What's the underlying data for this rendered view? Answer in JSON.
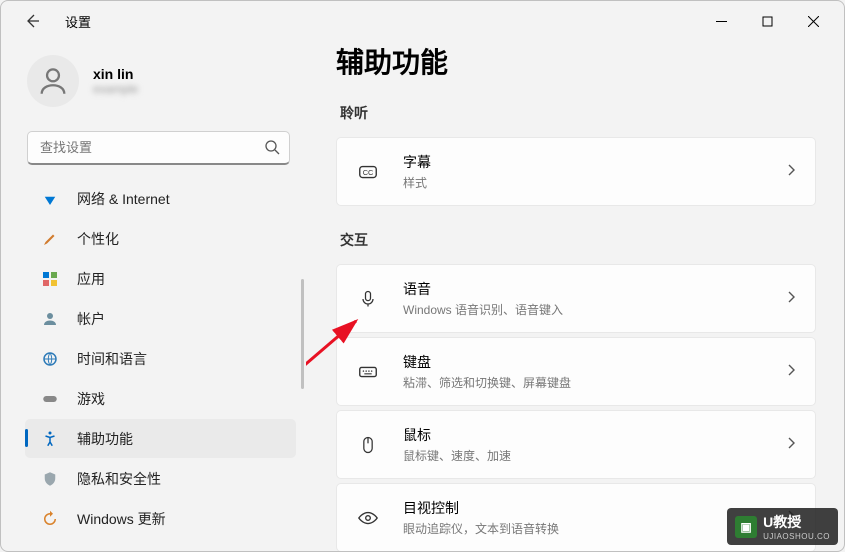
{
  "window": {
    "title": "设置"
  },
  "user": {
    "name": "xin lin",
    "email": "example"
  },
  "search": {
    "placeholder": "查找设置"
  },
  "sidebar": {
    "items": [
      {
        "label": "网络 & Internet"
      },
      {
        "label": "个性化"
      },
      {
        "label": "应用"
      },
      {
        "label": "帐户"
      },
      {
        "label": "时间和语言"
      },
      {
        "label": "游戏"
      },
      {
        "label": "辅助功能"
      },
      {
        "label": "隐私和安全性"
      },
      {
        "label": "Windows 更新"
      }
    ]
  },
  "main": {
    "title": "辅助功能",
    "section_listen": "聆听",
    "section_interact": "交互",
    "cards": {
      "captions": {
        "title": "字幕",
        "sub": "样式"
      },
      "voice": {
        "title": "语音",
        "sub": "Windows 语音识别、语音键入"
      },
      "keyboard": {
        "title": "键盘",
        "sub": "粘滞、筛选和切换键、屏幕键盘"
      },
      "mouse": {
        "title": "鼠标",
        "sub": "鼠标键、速度、加速"
      },
      "eye": {
        "title": "目视控制",
        "sub": "眼动追踪仪，文本到语音转换"
      }
    }
  },
  "watermark": {
    "brand": "U教授",
    "url": "UJIAOSHOU.CO"
  }
}
